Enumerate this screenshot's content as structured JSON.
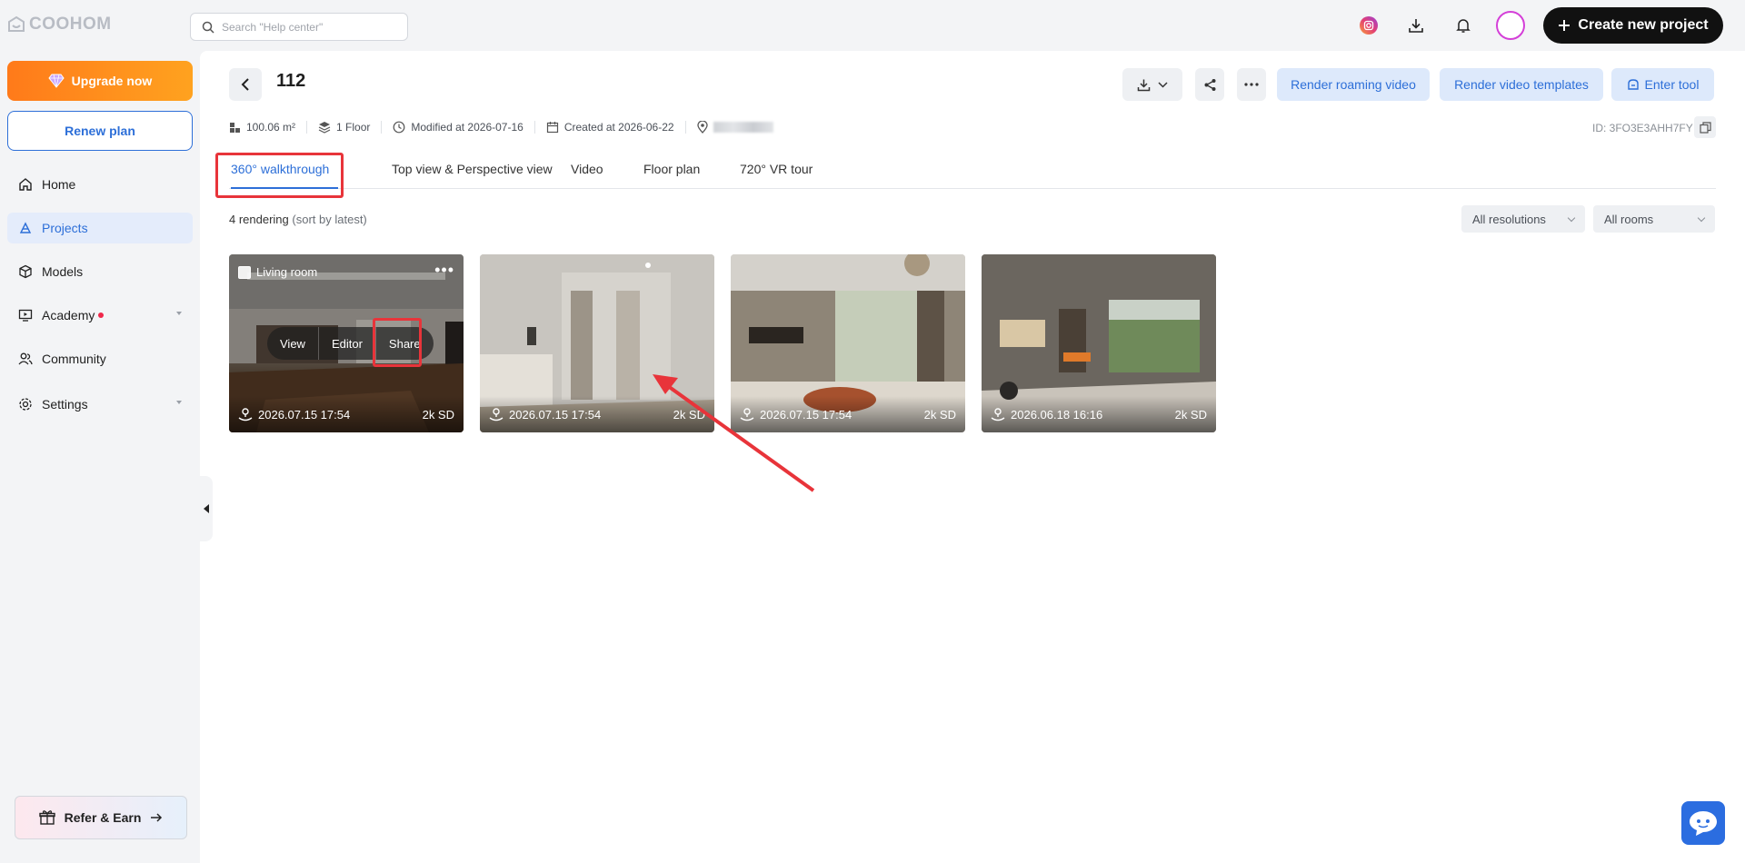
{
  "app": {
    "logo_text": "COOHOM"
  },
  "search": {
    "placeholder": "Search \"Help center\"",
    "value": ""
  },
  "topbar": {
    "create_label": "Create new project"
  },
  "sidebar": {
    "upgrade_label": "Upgrade now",
    "renew_label": "Renew plan",
    "items": [
      {
        "label": "Home"
      },
      {
        "label": "Projects"
      },
      {
        "label": "Models"
      },
      {
        "label": "Academy"
      },
      {
        "label": "Community"
      },
      {
        "label": "Settings"
      }
    ],
    "refer_label": "Refer & Earn"
  },
  "project": {
    "title": "112",
    "actions": {
      "roaming": "Render roaming video",
      "templates": "Render video templates",
      "enter": "Enter tool"
    },
    "meta": {
      "area": "100.06 m²",
      "floors": "1 Floor",
      "modified": "Modified at 2026-07-16",
      "created": "Created at 2026-06-22"
    },
    "id": "ID: 3FO3E3AHH7FY"
  },
  "tabs": [
    {
      "label": "360° walkthrough"
    },
    {
      "label": "Top view & Perspective view"
    },
    {
      "label": "Video"
    },
    {
      "label": "Floor plan"
    },
    {
      "label": "720° VR tour"
    }
  ],
  "list": {
    "count_label": "4 rendering",
    "sort_label": "(sort by latest)",
    "filters": {
      "resolution": "All resolutions",
      "rooms": "All rooms"
    }
  },
  "renderings": [
    {
      "room": "Living room",
      "date": "2026.07.15 17:54",
      "quality": "2k SD",
      "actions": {
        "view": "View",
        "editor": "Editor",
        "share": "Share"
      }
    },
    {
      "date": "2026.07.15 17:54",
      "quality": "2k SD"
    },
    {
      "date": "2026.07.15 17:54",
      "quality": "2k SD"
    },
    {
      "date": "2026.06.18 16:16",
      "quality": "2k SD"
    }
  ],
  "colors": {
    "accent": "#2d6fd8",
    "highlight": "#e8343a",
    "upgrade": "#ff8c1a",
    "create": "#111111"
  }
}
